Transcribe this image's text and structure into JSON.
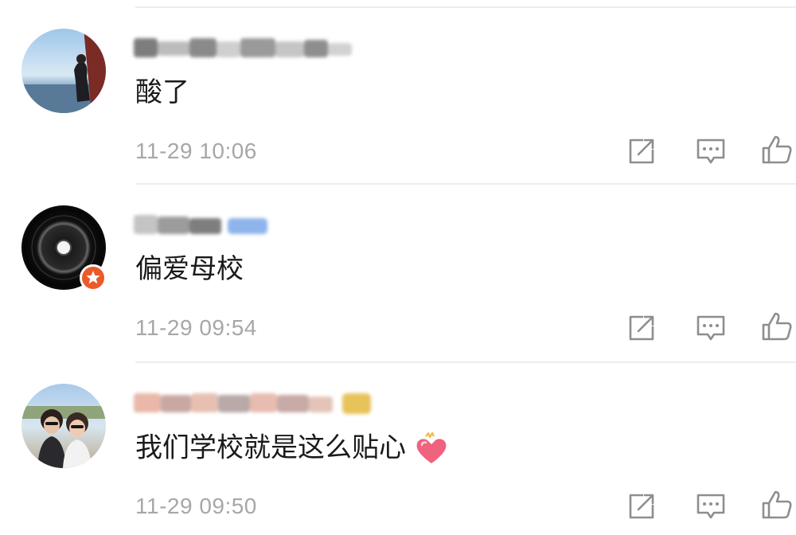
{
  "comments": [
    {
      "text": "酸了",
      "time": "11-29 10:06"
    },
    {
      "text": "偏爱母校",
      "time": "11-29 09:54"
    },
    {
      "text": "我们学校就是这么贴心",
      "time": "11-29 09:50"
    }
  ],
  "icons": {
    "share": "share-icon",
    "reply": "comment-icon",
    "like": "thumbs-up-icon",
    "heart": "heart-emoji-icon",
    "badge": "star-badge-icon"
  },
  "colors": {
    "text": "#1a1a1a",
    "meta": "#a7a7a7",
    "icon": "#8e8e8e",
    "badge": "#ea5a2a",
    "heart": "#f0627d"
  }
}
